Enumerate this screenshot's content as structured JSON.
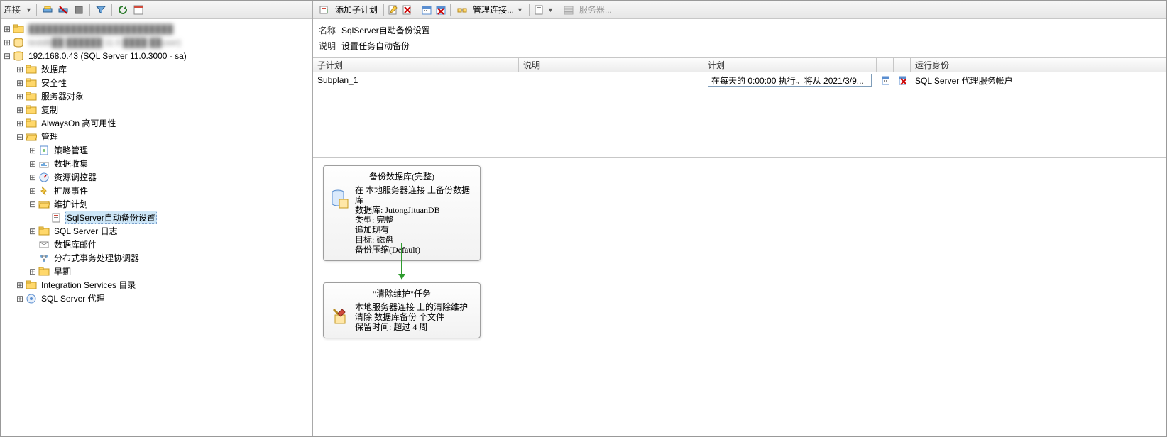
{
  "left_toolbar": {
    "connect_label": "连接"
  },
  "tree": {
    "root_blur_1": "████████████████████████",
    "root_blur_2": "testdb██    ██████ 11.0.████ ██user)",
    "server": "192.168.0.43 (SQL Server 11.0.3000 - sa)",
    "databases": "数据库",
    "security": "安全性",
    "server_objects": "服务器对象",
    "replication": "复制",
    "alwayson": "AlwaysOn 高可用性",
    "management": "管理",
    "policy_mgmt": "策略管理",
    "data_collect": "数据收集",
    "resource_gov": "资源调控器",
    "ext_events": "扩展事件",
    "maint_plans": "维护计划",
    "maint_plan_item": "SqlServer自动备份设置",
    "sql_logs": "SQL Server 日志",
    "db_mail": "数据库邮件",
    "dtc": "分布式事务处理协调器",
    "legacy": "早期",
    "ssis": "Integration Services 目录",
    "agent": "SQL Server 代理"
  },
  "right_toolbar": {
    "add_subplan": "添加子计划",
    "manage_conn": "管理连接...",
    "servers": "服务器..."
  },
  "props": {
    "name_label": "名称",
    "name_value": "SqlServer自动备份设置",
    "desc_label": "说明",
    "desc_value": "设置任务自动备份"
  },
  "grid": {
    "col_subplan": "子计划",
    "col_desc": "说明",
    "col_plan": "计划",
    "col_run_as": "运行身份",
    "row": {
      "subplan": "Subplan_1",
      "desc": "",
      "plan": "在每天的 0:00:00 执行。将从 2021/3/9...",
      "run_as": "SQL Server 代理服务帐户"
    }
  },
  "task1": {
    "title": "备份数据库(完整)",
    "l1": "在 本地服务器连接 上备份数据库",
    "l2": "数据库: JutongJituanDB",
    "l3": "类型: 完整",
    "l4": "追加现有",
    "l5": "目标: 磁盘",
    "l6": "备份压缩(Default)"
  },
  "task2": {
    "title": "\"清除维护\"任务",
    "l1": "本地服务器连接 上的清除维护",
    "l2": "清除 数据库备份 个文件",
    "l3": "保留时间: 超过 4 周"
  }
}
